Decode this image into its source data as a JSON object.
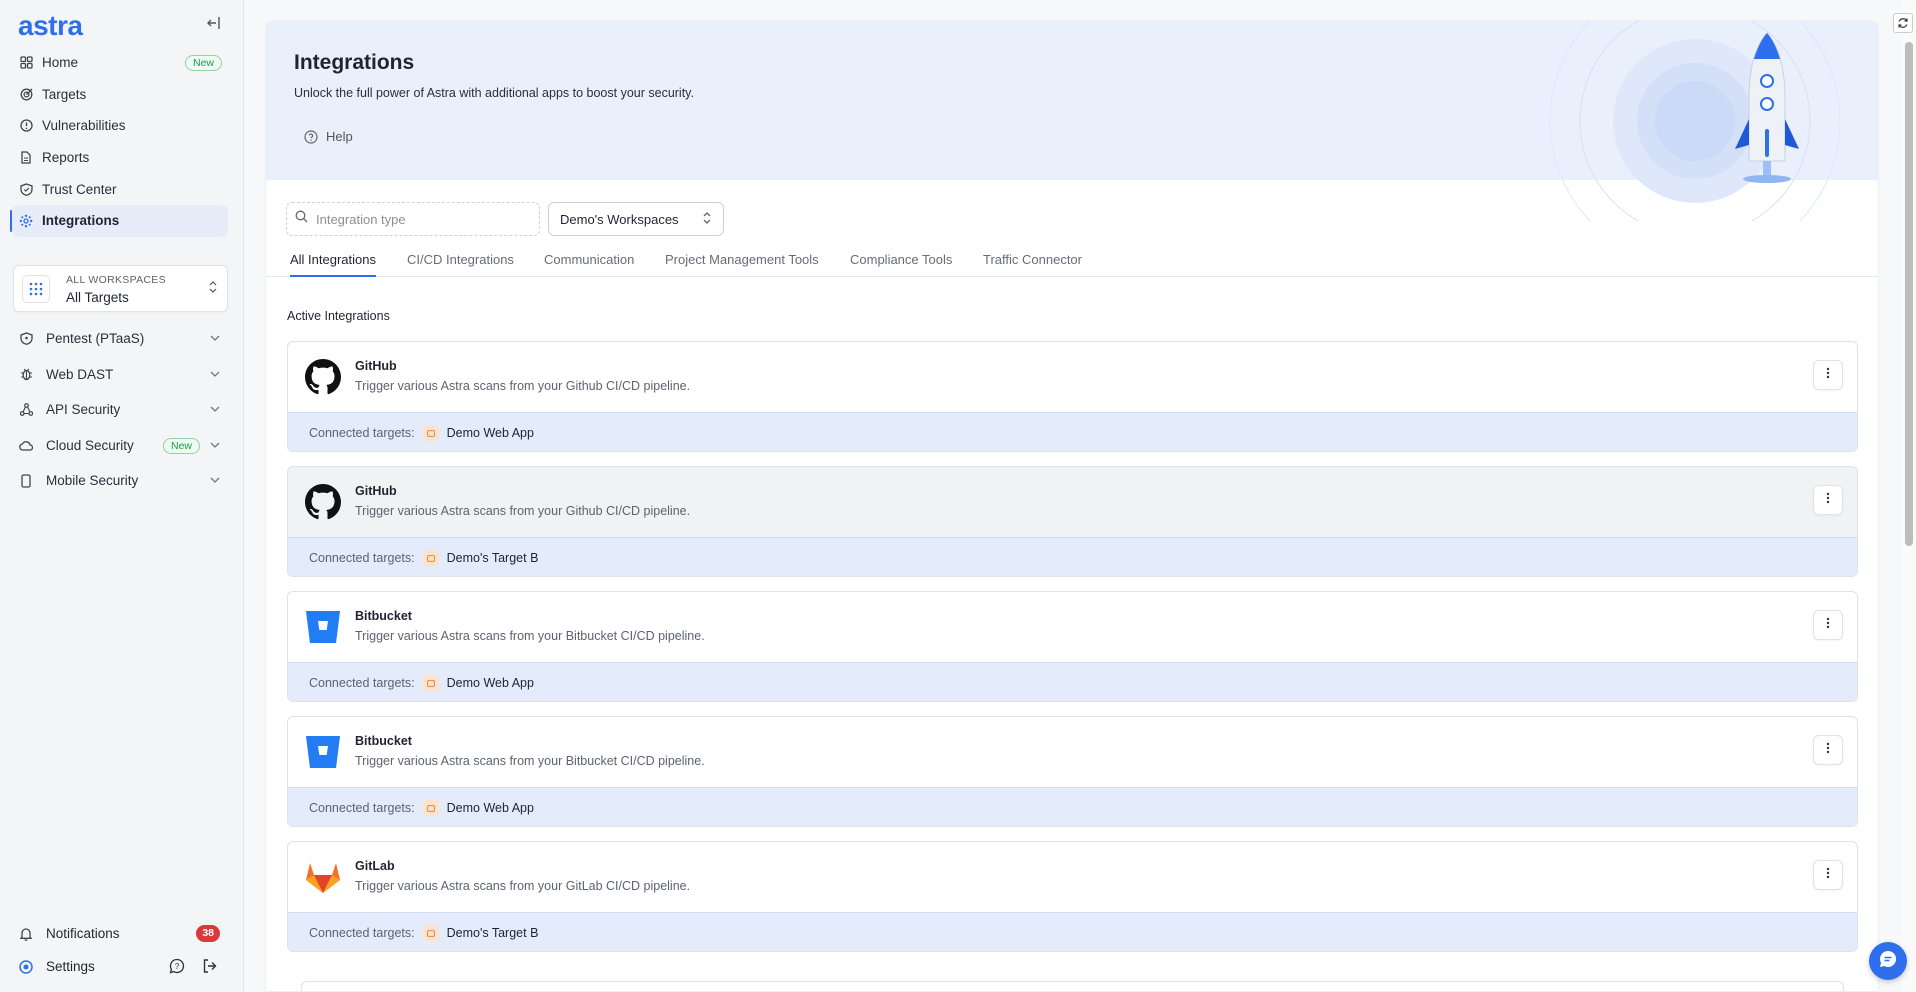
{
  "app": {
    "logo_text": "astra",
    "accent": "#2f6fed"
  },
  "sidebar": {
    "nav": [
      {
        "label": "Home",
        "icon": "grid-icon",
        "badge": "New"
      },
      {
        "label": "Targets",
        "icon": "target-icon"
      },
      {
        "label": "Vulnerabilities",
        "icon": "alert-circle-icon"
      },
      {
        "label": "Reports",
        "icon": "document-icon"
      },
      {
        "label": "Trust Center",
        "icon": "shield-check-icon"
      },
      {
        "label": "Integrations",
        "icon": "integrations-icon",
        "active": true
      }
    ],
    "workspace": {
      "label": "ALL WORKSPACES",
      "value": "All Targets"
    },
    "groups": [
      {
        "label": "Pentest (PTaaS)",
        "icon": "shield-icon"
      },
      {
        "label": "Web DAST",
        "icon": "bug-icon"
      },
      {
        "label": "API Security",
        "icon": "api-icon"
      },
      {
        "label": "Cloud Security",
        "icon": "cloud-icon",
        "badge": "New"
      },
      {
        "label": "Mobile Security",
        "icon": "mobile-icon"
      }
    ],
    "bottom": {
      "notifications_label": "Notifications",
      "notifications_count": "38",
      "settings_label": "Settings"
    }
  },
  "header": {
    "title": "Integrations",
    "subtitle": "Unlock the full power of Astra with additional apps to boost your security.",
    "help_label": "Help"
  },
  "filters": {
    "search_placeholder": "Integration type",
    "workspace_select": "Demo's Workspaces"
  },
  "tabs": [
    {
      "label": "All Integrations",
      "active": true
    },
    {
      "label": "CI/CD Integrations"
    },
    {
      "label": "Communication"
    },
    {
      "label": "Project Management Tools"
    },
    {
      "label": "Compliance Tools"
    },
    {
      "label": "Traffic Connector"
    }
  ],
  "active_section_title": "Active Integrations",
  "connected_label": "Connected targets:",
  "integrations": [
    {
      "name": "GitHub",
      "description": "Trigger various Astra scans from your Github CI/CD pipeline.",
      "target": "Demo Web App",
      "logo": "github-icon"
    },
    {
      "name": "GitHub",
      "description": "Trigger various Astra scans from your Github CI/CD pipeline.",
      "target": "Demo's Target B",
      "logo": "github-icon"
    },
    {
      "name": "Bitbucket",
      "description": "Trigger various Astra scans from your Bitbucket CI/CD pipeline.",
      "target": "Demo Web App",
      "logo": "bitbucket-icon"
    },
    {
      "name": "Bitbucket",
      "description": "Trigger various Astra scans from your Bitbucket CI/CD pipeline.",
      "target": "Demo Web App",
      "logo": "bitbucket-icon"
    },
    {
      "name": "GitLab",
      "description": "Trigger various Astra scans from your GitLab CI/CD pipeline.",
      "target": "Demo's Target B",
      "logo": "gitlab-icon"
    }
  ]
}
